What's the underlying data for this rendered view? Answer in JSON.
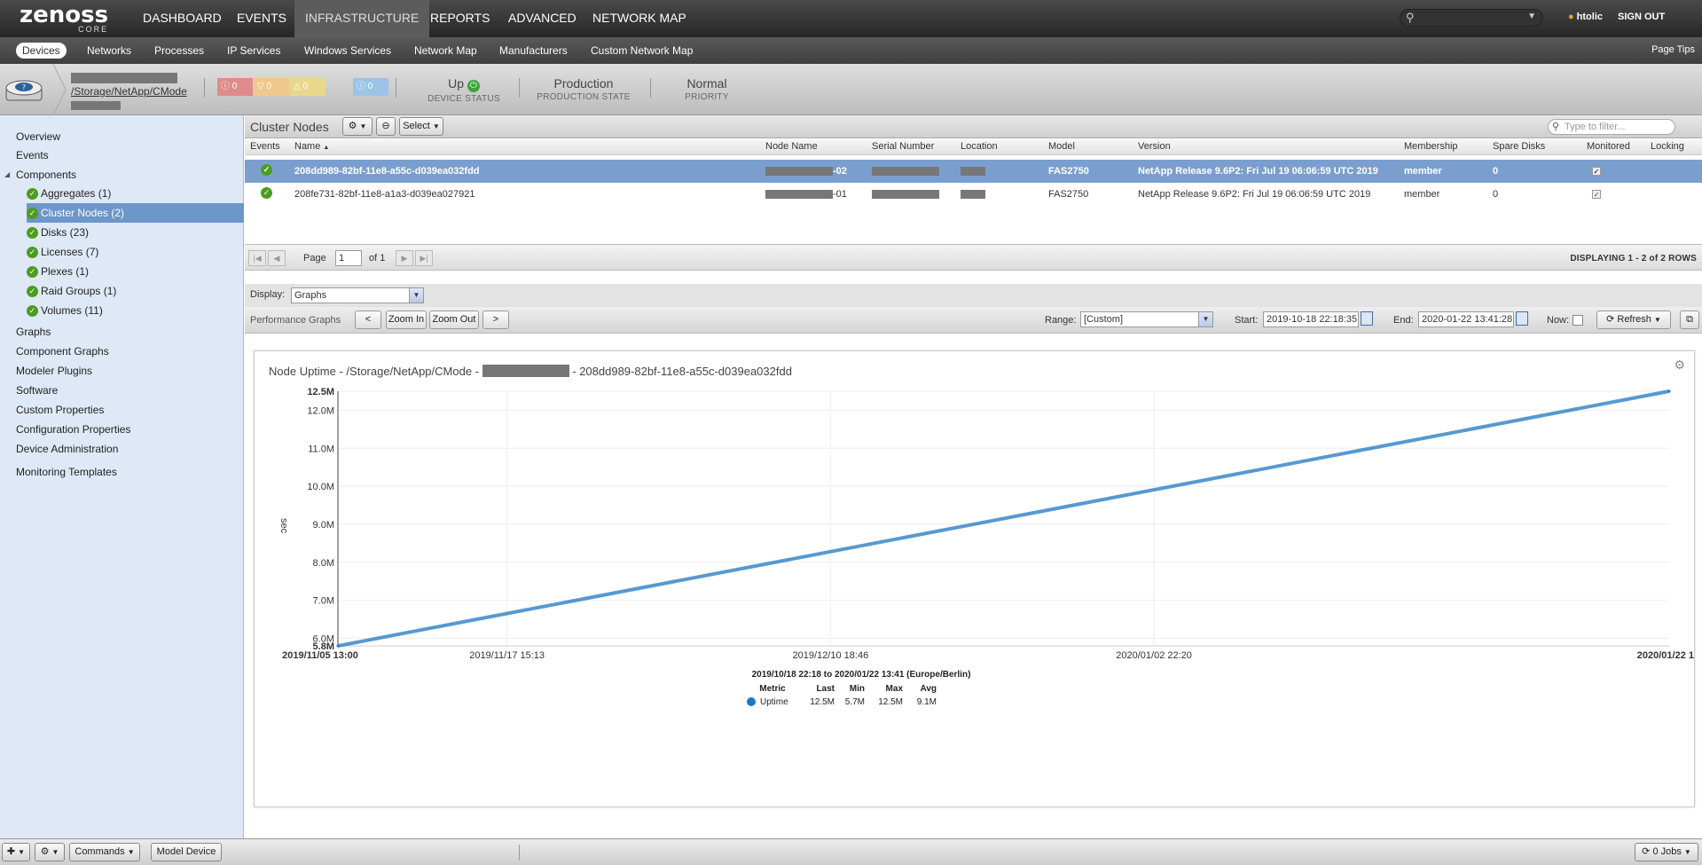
{
  "topnav": {
    "logo_main": "zenoss",
    "logo_sub": "CORE",
    "items": [
      "DASHBOARD",
      "EVENTS",
      "INFRASTRUCTURE",
      "REPORTS",
      "ADVANCED",
      "NETWORK MAP"
    ],
    "active": "INFRASTRUCTURE",
    "user": "htolic",
    "signout": "SIGN OUT"
  },
  "subnav": {
    "items": [
      "Devices",
      "Networks",
      "Processes",
      "IP Services",
      "Windows Services",
      "Network Map",
      "Manufacturers",
      "Custom Network Map"
    ],
    "active": "Devices",
    "page_tips": "Page Tips"
  },
  "device": {
    "path": "/Storage/NetApp/CMode",
    "events": [
      "0",
      "0",
      "0",
      "0"
    ],
    "event_colors": [
      "#e08b8b",
      "#f0c88c",
      "#e9d88c",
      "#9cc4e6"
    ],
    "status_value": "Up",
    "status_label": "DEVICE STATUS",
    "production_value": "Production",
    "production_label": "PRODUCTION STATE",
    "priority_value": "Normal",
    "priority_label": "PRIORITY"
  },
  "sidebar": {
    "top": [
      "Overview",
      "Events",
      "Components"
    ],
    "components": [
      "Aggregates (1)",
      "Cluster Nodes (2)",
      "Disks (23)",
      "Licenses (7)",
      "Plexes (1)",
      "Raid Groups (1)",
      "Volumes (11)"
    ],
    "selected_component": "Cluster Nodes (2)",
    "bottom": [
      "Graphs",
      "Component Graphs",
      "Modeler Plugins",
      "Software",
      "Custom Properties",
      "Configuration Properties",
      "Device Administration",
      "Monitoring Templates"
    ]
  },
  "cluster": {
    "title": "Cluster Nodes",
    "select_label": "Select",
    "filter_placeholder": "Type to filter...",
    "columns": [
      "Events",
      "Name",
      "Node Name",
      "Serial Number",
      "Location",
      "Model",
      "Version",
      "Membership",
      "Spare Disks",
      "Monitored",
      "Locking"
    ],
    "rows": [
      {
        "name": "208dd989-82bf-11e8-a55c-d039ea032fdd",
        "node_suffix": "-02",
        "model": "FAS2750",
        "version": "NetApp Release 9.6P2: Fri Jul 19 06:06:59 UTC 2019",
        "membership": "member",
        "spare_disks": "0"
      },
      {
        "name": "208fe731-82bf-11e8-a1a3-d039ea027921",
        "node_suffix": "-01",
        "model": "FAS2750",
        "version": "NetApp Release 9.6P2: Fri Jul 19 06:06:59 UTC 2019",
        "membership": "member",
        "spare_disks": "0"
      }
    ]
  },
  "pager": {
    "page_label": "Page",
    "page_value": "1",
    "of_label": "of 1",
    "displaying": "DISPLAYING 1 - 2 of 2 ROWS"
  },
  "display": {
    "label": "Display:",
    "value": "Graphs"
  },
  "perf": {
    "label": "Performance Graphs",
    "prev": "<",
    "zoom_in": "Zoom In",
    "zoom_out": "Zoom Out",
    "next": ">",
    "range_label": "Range:",
    "range_value": "[Custom]",
    "start_label": "Start:",
    "start_value": "2019-10-18 22:18:35",
    "end_label": "End:",
    "end_value": "2020-01-22 13:41:28",
    "now_label": "Now:",
    "refresh_label": "Refresh"
  },
  "chart_data": {
    "type": "line",
    "title_prefix": "Node Uptime - /Storage/NetApp/CMode -",
    "title_suffix": "- 208dd989-82bf-11e8-a55c-d039ea032fdd",
    "ylabel": "sec",
    "ylim": [
      5.8,
      12.5
    ],
    "yticks": [
      "12.5M",
      "12.0M",
      "11.0M",
      "10.0M",
      "9.0M",
      "8.0M",
      "7.0M",
      "6.0M",
      "5.8M"
    ],
    "ytick_values": [
      12.5,
      12.0,
      11.0,
      10.0,
      9.0,
      8.0,
      7.0,
      6.0,
      5.8
    ],
    "xticks": [
      "2019/11/05 13:00",
      "2019/11/17 15:13",
      "2019/12/10 18:46",
      "2020/01/02 22:20",
      "2020/01/22 1"
    ],
    "grid": true,
    "series": [
      {
        "name": "Uptime",
        "color": "#1f78c1",
        "x": [
          "2019/11/05 13:00",
          "2020/01/22 13:41"
        ],
        "values": [
          5.8,
          12.5
        ]
      }
    ],
    "legend_range": "2019/10/18 22:18 to 2020/01/22 13:41 (Europe/Berlin)",
    "legend_columns": [
      "Metric",
      "Last",
      "Min",
      "Max",
      "Avg"
    ],
    "legend_row": [
      "Uptime",
      "12.5M",
      "5.7M",
      "12.5M",
      "9.1M"
    ]
  },
  "bottombar": {
    "commands": "Commands",
    "model_device": "Model Device",
    "jobs": "0 Jobs"
  }
}
